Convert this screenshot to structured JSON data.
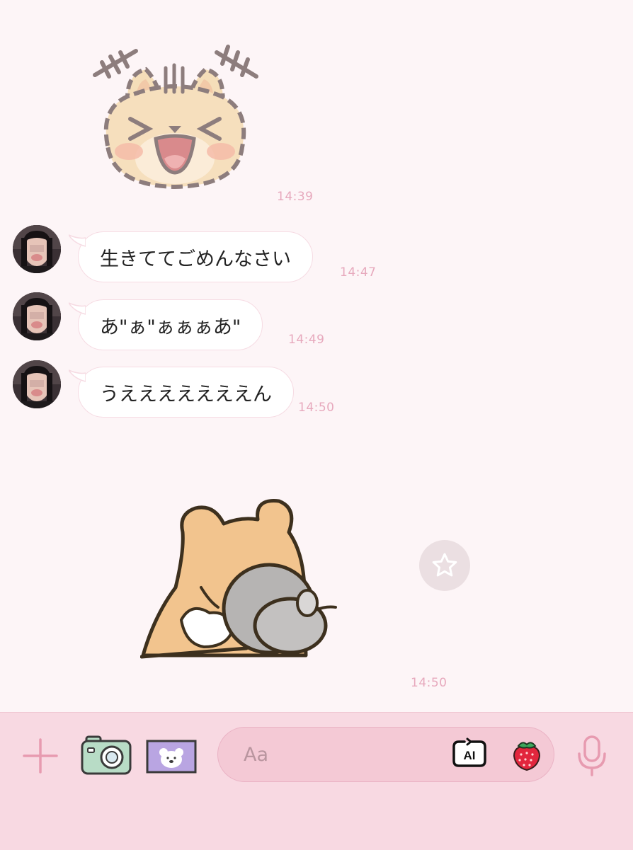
{
  "messages": [
    {
      "type": "sticker",
      "sticker": "laughing-cat-sticker",
      "time": "14:39"
    },
    {
      "type": "text",
      "text": "生きててごめんなさい",
      "time": "14:47"
    },
    {
      "type": "text",
      "text": "あ\"ぁ\"ぁぁぁあ\"",
      "time": "14:49"
    },
    {
      "type": "text",
      "text": "うえええええええん",
      "time": "14:50"
    },
    {
      "type": "sticker",
      "sticker": "hamster-hugging-ball-sticker",
      "time": "14:50"
    }
  ],
  "composer": {
    "placeholder": "Aa",
    "value": "",
    "ai_label": "AI"
  },
  "icons": {
    "plus": "plus-icon",
    "camera": "camera-icon",
    "image": "bear-image-icon",
    "ai": "ai-icon",
    "emoji": "strawberry-icon",
    "mic": "microphone-icon",
    "favorite": "star-icon"
  },
  "colors": {
    "background": "#fdf5f7",
    "bar": "#f8d9e2",
    "accent": "#e7a9bd",
    "bubble": "#ffffff"
  }
}
